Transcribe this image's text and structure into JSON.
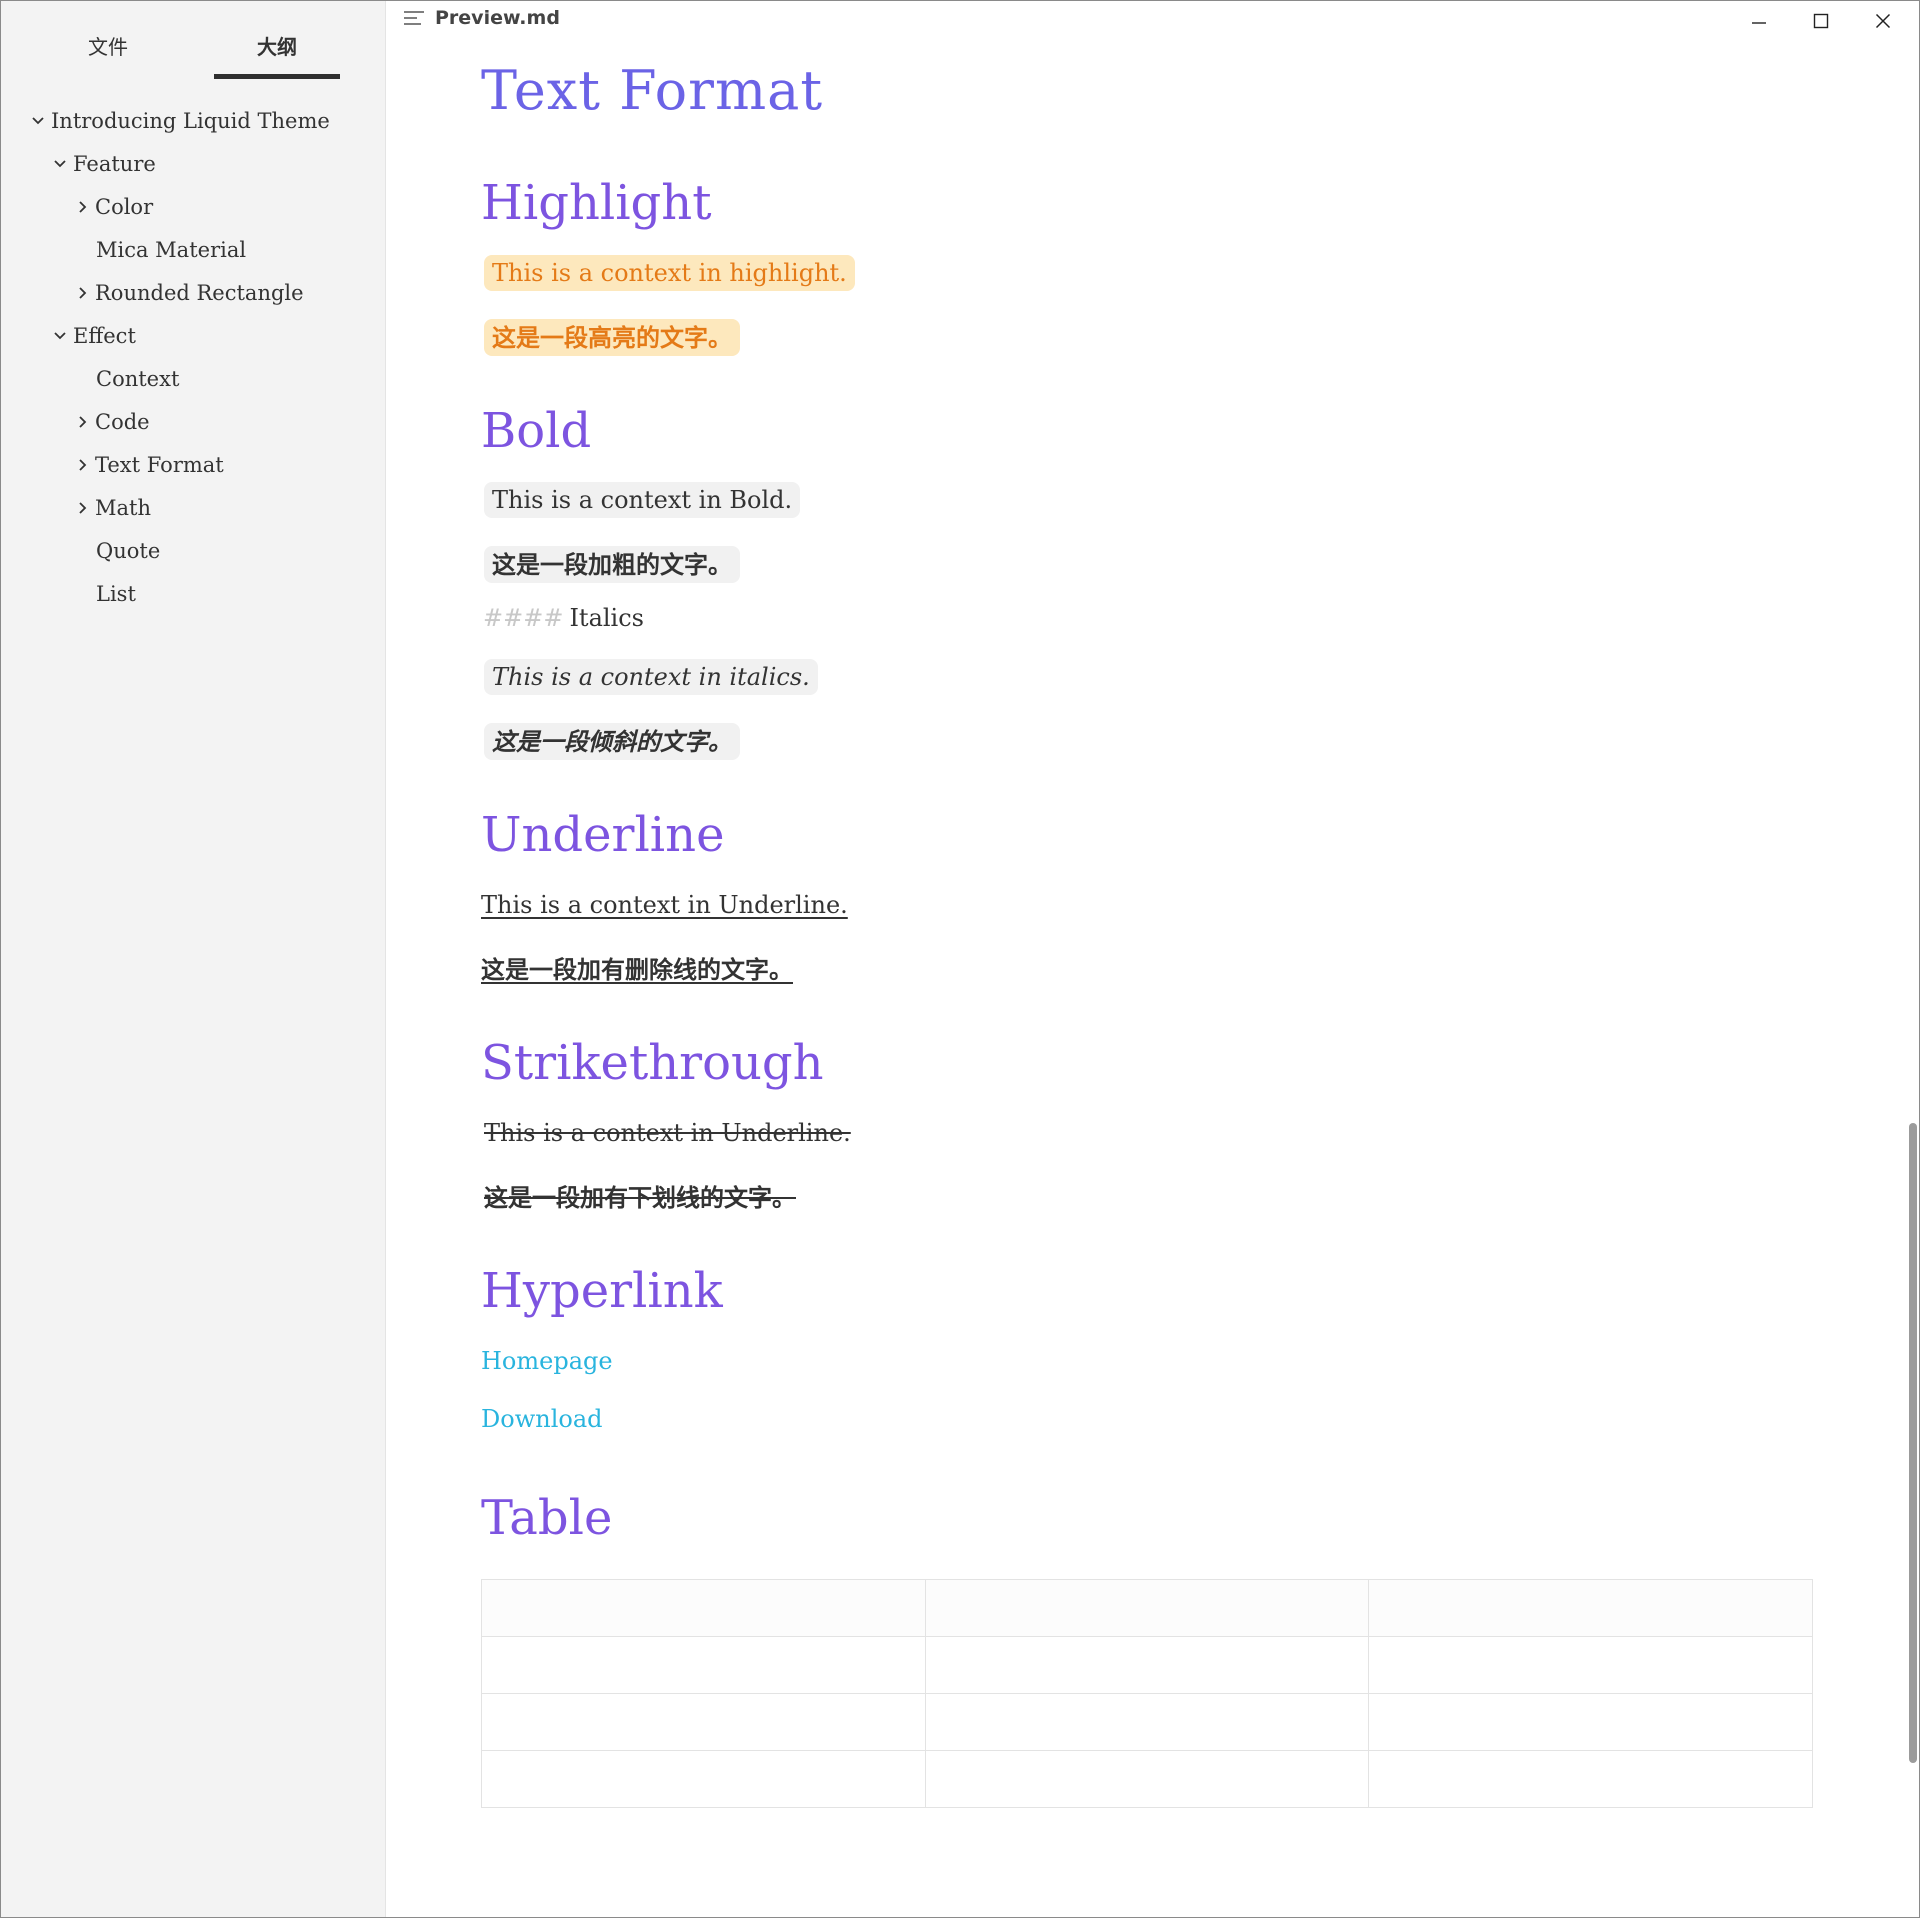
{
  "window": {
    "title": "Preview.md",
    "controls": {
      "minimize": "minimize",
      "maximize": "maximize",
      "close": "close"
    }
  },
  "sidebar": {
    "tabs": [
      {
        "label": "文件"
      },
      {
        "label": "大纲"
      }
    ],
    "active_tab": 1,
    "outline": [
      {
        "label": "Introducing Liquid Theme",
        "level": 1,
        "chevron": "down"
      },
      {
        "label": "Feature",
        "level": 2,
        "chevron": "down"
      },
      {
        "label": "Color",
        "level": 3,
        "chevron": "right"
      },
      {
        "label": "Mica Material",
        "level": 3,
        "chevron": "none"
      },
      {
        "label": "Rounded Rectangle",
        "level": 3,
        "chevron": "right"
      },
      {
        "label": "Effect",
        "level": 2,
        "chevron": "down"
      },
      {
        "label": "Context",
        "level": 3,
        "chevron": "none"
      },
      {
        "label": "Code",
        "level": 3,
        "chevron": "right"
      },
      {
        "label": "Text Format",
        "level": 3,
        "chevron": "right"
      },
      {
        "label": "Math",
        "level": 3,
        "chevron": "right"
      },
      {
        "label": "Quote",
        "level": 3,
        "chevron": "none"
      },
      {
        "label": "List",
        "level": 3,
        "chevron": "none"
      }
    ]
  },
  "content": {
    "heading_text_format": "Text Format",
    "highlight": {
      "heading": "Highlight",
      "en": "This is a context in highlight.",
      "cn": "这是一段高亮的文字。"
    },
    "bold": {
      "heading": "Bold",
      "en": "This is a context in Bold.",
      "cn": "这是一段加粗的文字。"
    },
    "italics": {
      "hashes": "####",
      "heading": "Italics",
      "en": "This is a context in italics.",
      "cn": "这是一段倾斜的文字。"
    },
    "underline": {
      "heading": "Underline",
      "en": "This is a context in Underline.",
      "cn": "这是一段加有删除线的文字。"
    },
    "strikethrough": {
      "heading": "Strikethrough",
      "en": "This is a context in Underline.",
      "cn": "这是一段加有下划线的文字。"
    },
    "hyperlink": {
      "heading": "Hyperlink",
      "links": [
        "Homepage",
        "Download"
      ]
    },
    "table": {
      "heading": "Table",
      "rows": 4,
      "cols": 3
    }
  },
  "colors": {
    "heading": "#6b63e6",
    "highlight_bg": "#fde8bd",
    "highlight_text": "#e47a17",
    "link": "#29b4de",
    "sidebar_bg": "#f3f3f3"
  }
}
